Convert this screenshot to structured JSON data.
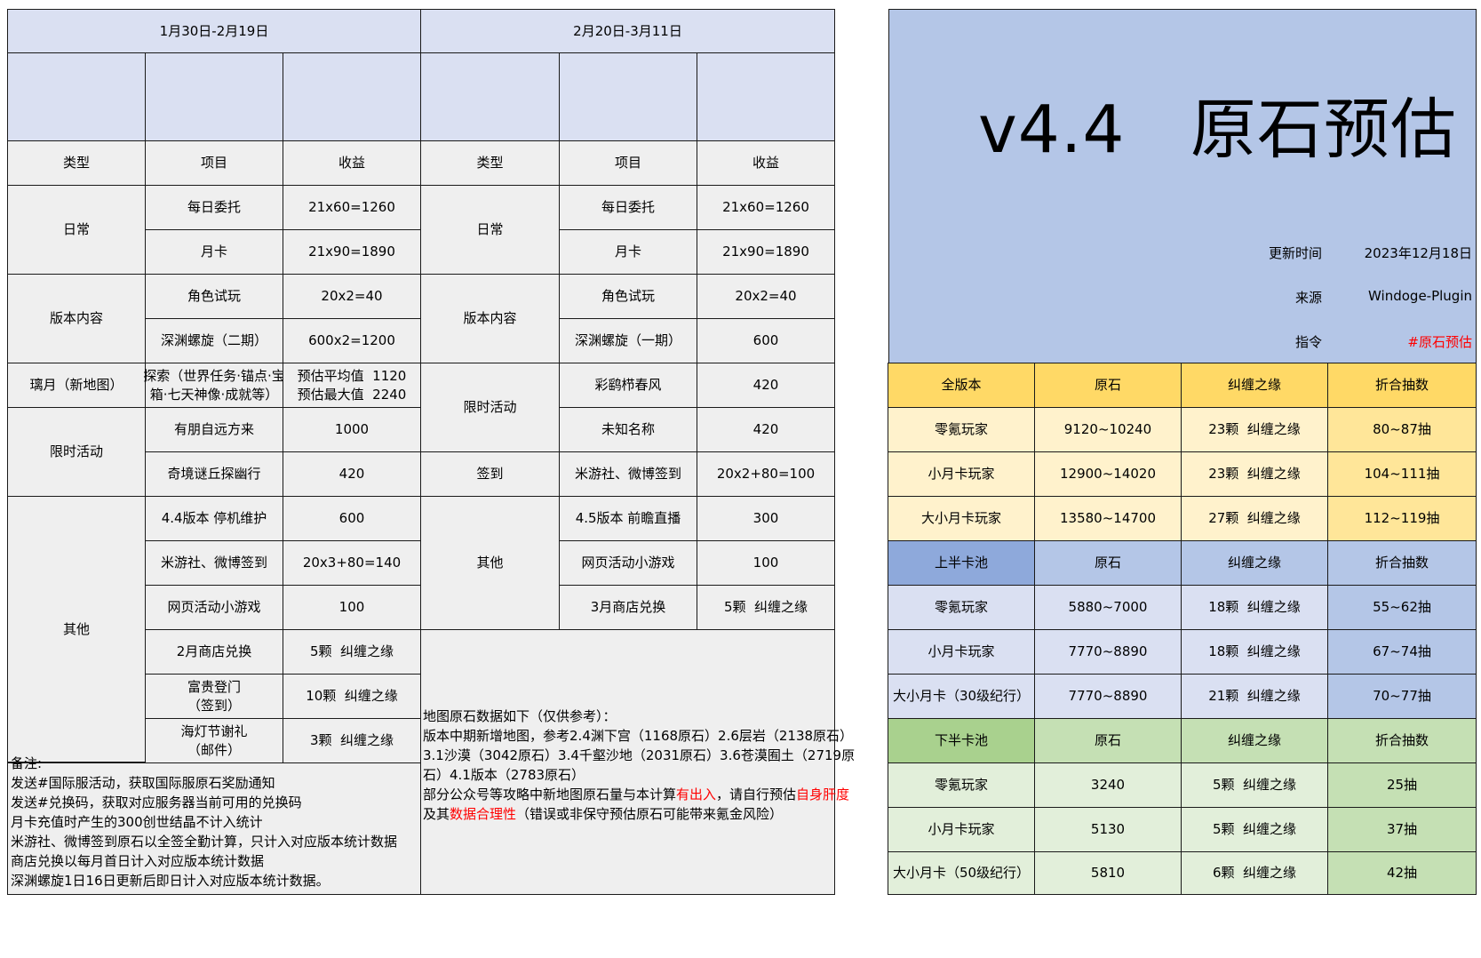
{
  "left": {
    "period": "1月30日-2月19日",
    "headers": [
      "类型",
      "项目",
      "收益"
    ],
    "cat_daily": "日常",
    "daily_commission": "每日委托",
    "daily_commission_val": "21x60=1260",
    "monthly_card": "月卡",
    "monthly_card_val": "21x90=1890",
    "cat_version": "版本内容",
    "trial": "角色试玩",
    "trial_val": "20x2=40",
    "abyss": "深渊螺旋（二期）",
    "abyss_val": "600x2=1200",
    "cat_map": "璃月（新地图）",
    "explore_line1": "探索（世界任务·锚点·宝",
    "explore_line2": "箱·七天神像·成就等）",
    "explore_val1": "预估平均值  1120",
    "explore_val2": "预估最大值  2240",
    "cat_event": "限时活动",
    "event1": "有朋自远方来",
    "event1_val": "1000",
    "event2": "奇境谜丘探幽行",
    "event2_val": "420",
    "cat_other": "其他",
    "other1": "4.4版本 停机维护",
    "other1_val": "600",
    "other2": "米游社、微博签到",
    "other2_val": "20x3+80=140",
    "other3": "网页活动小游戏",
    "other3_val": "100",
    "other4": "2月商店兑换",
    "other4_val": "5颗  纠缠之缘",
    "other5_line1": "富贵登门",
    "other5_line2": "（签到）",
    "other5_val": "10颗  纠缠之缘",
    "other6_line1": "海灯节谢礼",
    "other6_line2": "（邮件）",
    "other6_val": "3颗  纠缠之缘"
  },
  "notes": {
    "lines": [
      "备注:",
      "发送#国际服活动，获取国际服原石奖励通知",
      "发送#兑换码，获取对应服务器当前可用的兑换码",
      "月卡充值时产生的300创世结晶不计入统计",
      "米游社、微博签到原石以全签全勤计算，只计入对应版本统计数据",
      "商店兑换以每月首日计入对应版本统计数据",
      "深渊螺旋1日16日更新后即日计入对应版本统计数据。"
    ]
  },
  "middle": {
    "period": "2月20日-3月11日",
    "headers": [
      "类型",
      "项目",
      "收益"
    ],
    "cat_daily": "日常",
    "daily_commission": "每日委托",
    "daily_commission_val": "21x60=1260",
    "monthly_card": "月卡",
    "monthly_card_val": "21x90=1890",
    "cat_version": "版本内容",
    "trial": "角色试玩",
    "trial_val": "20x2=40",
    "abyss": "深渊螺旋（一期）",
    "abyss_val": "600",
    "cat_event": "限时活动",
    "event1": "彩鹞栉春风",
    "event1_val": "420",
    "event2": "未知名称",
    "event2_val": "420",
    "cat_signin": "签到",
    "signin": "米游社、微博签到",
    "signin_val": "20x2+80=100",
    "cat_other": "其他",
    "other1": "4.5版本 前瞻直播",
    "other1_val": "300",
    "other2": "网页活动小游戏",
    "other2_val": "100",
    "other3": "3月商店兑换",
    "other3_val": "5颗  纠缠之缘"
  },
  "map_note": {
    "line1": "地图原石数据如下（仅供参考）：",
    "line2": "版本中期新增地图，参考2.4渊下宫（1168原石）2.6层岩（2138原石）",
    "line3": "3.1沙漠（3042原石）3.4千壑沙地（2031原石）3.6苍漠囿土（2719原",
    "line4": "石）4.1版本（2783原石）",
    "line5_a": "部分公众号等攻略中新地图原石量与本计算",
    "line5_b": "有出入",
    "line5_c": "，请自行预估",
    "line5_d": "自身肝度",
    "line6_a": "及其",
    "line6_b": "数据合理性",
    "line6_c": "（错误或非保守预估原石可能带来氪金风险）"
  },
  "hero": {
    "title": "v4.4   原石预估",
    "update_label": "更新时间",
    "update_value": "2023年12月18日",
    "source_label": "来源",
    "source_value": "Windoge-Plugin",
    "command_label": "指令",
    "command_value": "#原石预估",
    "command_color": "#ff0000",
    "bg_color": "#b4c6e7"
  },
  "summary": {
    "full": {
      "headers": [
        "全版本",
        "原石",
        "纠缠之缘",
        "折合抽数"
      ],
      "rows": [
        [
          "零氪玩家",
          "9120~10240",
          "23颗  纠缠之缘",
          "80~87抽"
        ],
        [
          "小月卡玩家",
          "12900~14020",
          "23颗  纠缠之缘",
          "104~111抽"
        ],
        [
          "大小月卡玩家",
          "13580~14700",
          "27颗  纠缠之缘",
          "112~119抽"
        ]
      ]
    },
    "first_half": {
      "headers": [
        "上半卡池",
        "原石",
        "纠缠之缘",
        "折合抽数"
      ],
      "rows": [
        [
          "零氪玩家",
          "5880~7000",
          "18颗  纠缠之缘",
          "55~62抽"
        ],
        [
          "小月卡玩家",
          "7770~8890",
          "18颗  纠缠之缘",
          "67~74抽"
        ],
        [
          "大小月卡（30级纪行）",
          "7770~8890",
          "21颗  纠缠之缘",
          "70~77抽"
        ]
      ]
    },
    "second_half": {
      "headers": [
        "下半卡池",
        "原石",
        "纠缠之缘",
        "折合抽数"
      ],
      "rows": [
        [
          "零氪玩家",
          "3240",
          "5颗  纠缠之缘",
          "25抽"
        ],
        [
          "小月卡玩家",
          "5130",
          "5颗  纠缠之缘",
          "37抽"
        ],
        [
          "大小月卡（50级纪行）",
          "5810",
          "6颗  纠缠之缘",
          "42抽"
        ]
      ]
    }
  }
}
